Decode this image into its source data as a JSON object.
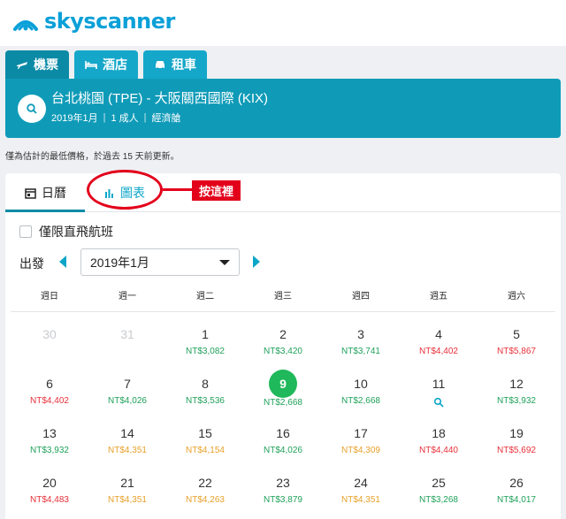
{
  "brand": {
    "name": "skyscanner"
  },
  "tabs": [
    {
      "label": "機票",
      "icon": "plane-icon",
      "active": true
    },
    {
      "label": "酒店",
      "icon": "bed-icon",
      "active": false
    },
    {
      "label": "租車",
      "icon": "car-icon",
      "active": false
    }
  ],
  "search": {
    "route": "台北桃園 (TPE) - 大阪關西國際 (KIX)",
    "month": "2019年1月",
    "passengers": "1 成人",
    "cabin": "經濟艙",
    "separator": "|"
  },
  "notice": "僅為估計的最低價格，於過去 15 天前更新。",
  "view_tabs": {
    "calendar": "日曆",
    "chart": "圖表"
  },
  "annotation": "按這裡",
  "direct_only": "僅限直飛航班",
  "depart_label": "出發",
  "month_select": "2019年1月",
  "weekdays": [
    "週日",
    "週一",
    "週二",
    "週三",
    "週四",
    "週五",
    "週六"
  ],
  "colors": {
    "green": "#1fa15a",
    "orange": "#e8a12a",
    "red": "#e8303a",
    "accent": "#0aa6c8"
  },
  "days": [
    {
      "day": "30",
      "price": "",
      "level": "none",
      "past": true
    },
    {
      "day": "31",
      "price": "",
      "level": "none",
      "past": true
    },
    {
      "day": "1",
      "price": "NT$3,082",
      "level": "green"
    },
    {
      "day": "2",
      "price": "NT$3,420",
      "level": "green"
    },
    {
      "day": "3",
      "price": "NT$3,741",
      "level": "green"
    },
    {
      "day": "4",
      "price": "NT$4,402",
      "level": "red"
    },
    {
      "day": "5",
      "price": "NT$5,867",
      "level": "red"
    },
    {
      "day": "6",
      "price": "NT$4,402",
      "level": "red"
    },
    {
      "day": "7",
      "price": "NT$4,026",
      "level": "green"
    },
    {
      "day": "8",
      "price": "NT$3,536",
      "level": "green"
    },
    {
      "day": "9",
      "price": "NT$2,668",
      "level": "green",
      "selected": true
    },
    {
      "day": "10",
      "price": "NT$2,668",
      "level": "green"
    },
    {
      "day": "11",
      "price": "",
      "level": "none",
      "search_icon": true
    },
    {
      "day": "12",
      "price": "NT$3,932",
      "level": "green"
    },
    {
      "day": "13",
      "price": "NT$3,932",
      "level": "green"
    },
    {
      "day": "14",
      "price": "NT$4,351",
      "level": "orange"
    },
    {
      "day": "15",
      "price": "NT$4,154",
      "level": "orange"
    },
    {
      "day": "16",
      "price": "NT$4,026",
      "level": "green"
    },
    {
      "day": "17",
      "price": "NT$4,309",
      "level": "orange"
    },
    {
      "day": "18",
      "price": "NT$4,440",
      "level": "red"
    },
    {
      "day": "19",
      "price": "NT$5,692",
      "level": "red"
    },
    {
      "day": "20",
      "price": "NT$4,483",
      "level": "red"
    },
    {
      "day": "21",
      "price": "NT$4,351",
      "level": "orange"
    },
    {
      "day": "22",
      "price": "NT$4,263",
      "level": "orange"
    },
    {
      "day": "23",
      "price": "NT$3,879",
      "level": "green"
    },
    {
      "day": "24",
      "price": "NT$4,351",
      "level": "orange"
    },
    {
      "day": "25",
      "price": "NT$3,268",
      "level": "green"
    },
    {
      "day": "26",
      "price": "NT$4,017",
      "level": "green"
    }
  ]
}
